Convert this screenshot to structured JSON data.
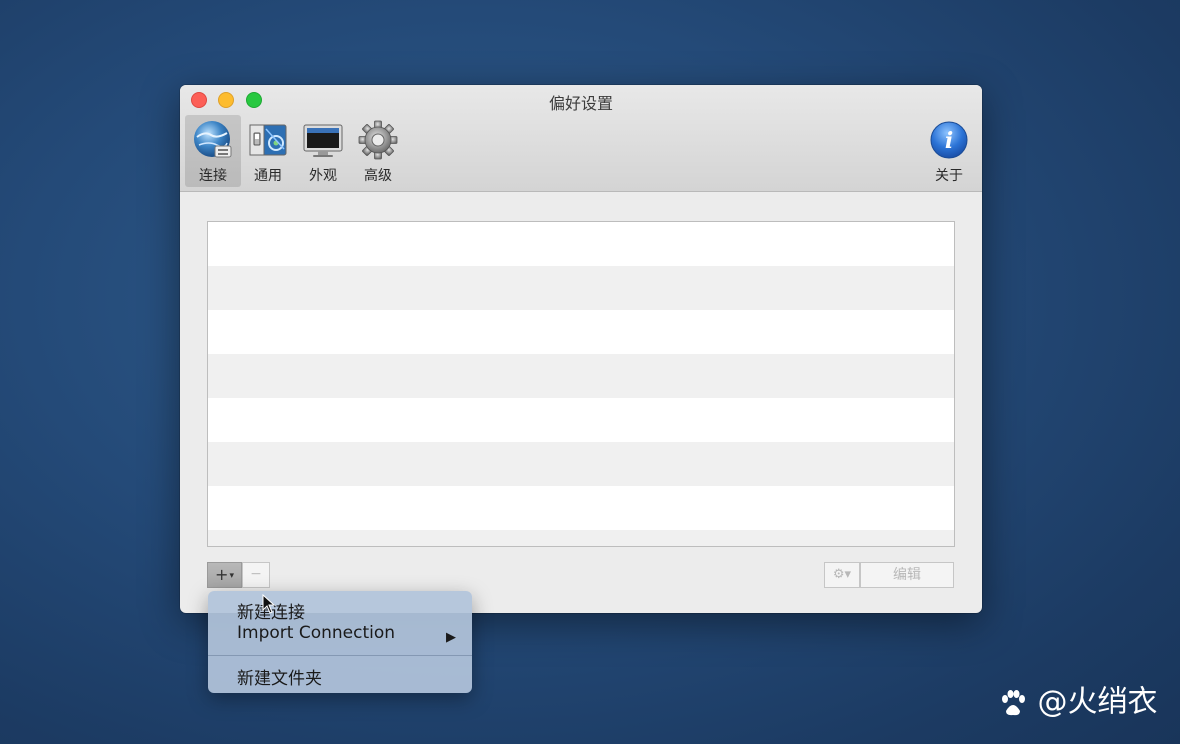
{
  "window": {
    "title": "偏好设置"
  },
  "toolbar": {
    "tabs": [
      {
        "label": "连接",
        "icon": "globe-connection-icon",
        "selected": true
      },
      {
        "label": "通用",
        "icon": "switch-panel-icon",
        "selected": false
      },
      {
        "label": "外观",
        "icon": "monitor-icon",
        "selected": false
      },
      {
        "label": "高级",
        "icon": "gear-icon",
        "selected": false
      }
    ],
    "about": {
      "label": "关于",
      "icon": "info-icon"
    }
  },
  "connections": {
    "rows": 8
  },
  "bottom_bar": {
    "add_label": "+",
    "add_caret": "▾",
    "remove_label": "−",
    "gear_label": "⚙▾",
    "edit_label": "编辑"
  },
  "add_menu": {
    "items": [
      {
        "label": "新建连接"
      },
      {
        "label": "Import Connection",
        "submenu": "▶"
      },
      {
        "label": "新建文件夹"
      }
    ]
  },
  "watermark": {
    "text": "@火绡衣"
  }
}
